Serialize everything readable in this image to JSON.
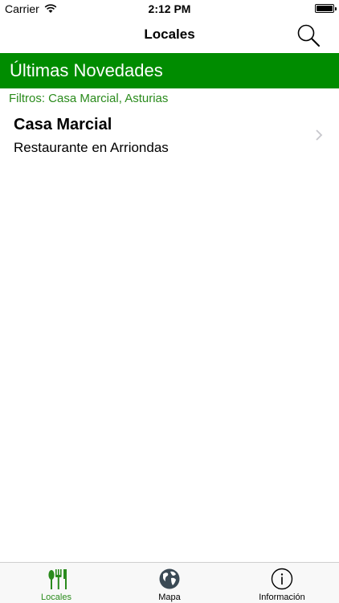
{
  "status_bar": {
    "carrier": "Carrier",
    "time": "2:12 PM",
    "battery_level": 1.0
  },
  "nav": {
    "title": "Locales",
    "search_icon": "search-icon"
  },
  "section": {
    "header": "Últimas Novedades",
    "filters": "Filtros: Casa Marcial, Asturias"
  },
  "list": {
    "items": [
      {
        "title": "Casa Marcial",
        "subtitle": "Restaurante en Arriondas"
      }
    ]
  },
  "tab_bar": {
    "active_color": "#2a8b1c",
    "tabs": [
      {
        "label": "Locales",
        "icon": "cutlery-icon",
        "active": true
      },
      {
        "label": "Mapa",
        "icon": "globe-icon",
        "active": false
      },
      {
        "label": "Información",
        "icon": "info-icon",
        "active": false
      }
    ]
  },
  "colors": {
    "header_green": "#008c00",
    "filter_green": "#2a8b1c"
  }
}
